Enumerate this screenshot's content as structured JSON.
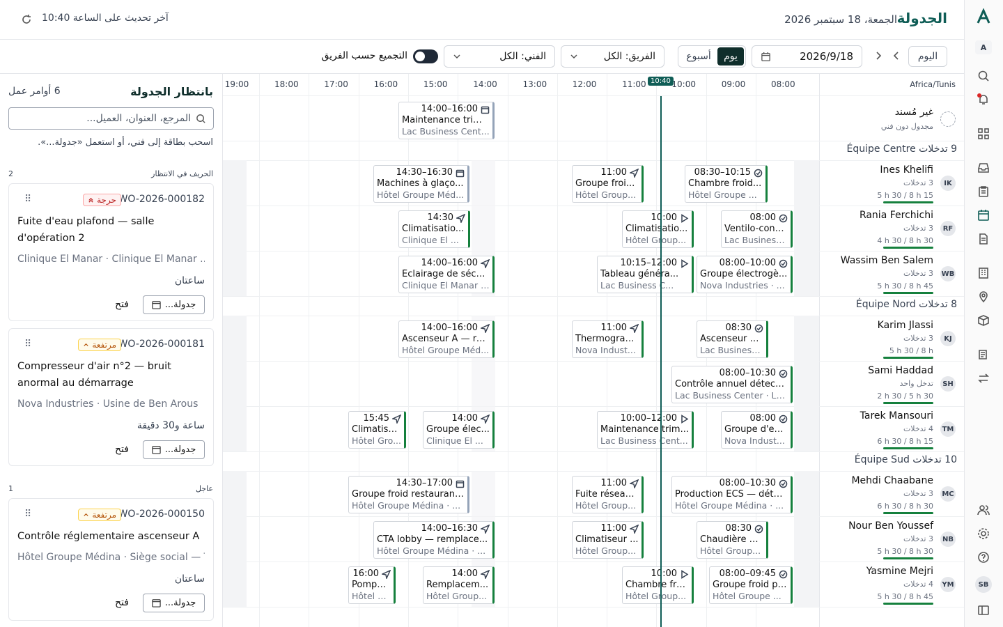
{
  "header": {
    "title": "الجدولة",
    "date": "الجمعة، 18 سبتمبر 2026",
    "last_update": "آخر تحديث على الساعة 10:40"
  },
  "toolbar": {
    "today": "اليوم",
    "date_value": "2026/9/18",
    "view_day": "يوم",
    "view_week": "أسبوع",
    "team_filter": "الفريق: الكل",
    "tech_filter": "الفني: الكل",
    "group_by_team": "التجميع حسب الفريق",
    "timezone": "Africa/Tunis"
  },
  "hours": [
    "08:00",
    "09:00",
    "10:00",
    "11:00",
    "12:00",
    "13:00",
    "14:00",
    "15:00",
    "16:00",
    "17:00",
    "18:00",
    "19:00"
  ],
  "now_label": "10:40",
  "unassigned": {
    "title": "غير مُسند",
    "sub": "مجدول دون فني"
  },
  "teams": [
    {
      "name": "Équipe Centre",
      "count": "9 تدخلات"
    },
    {
      "name": "Équipe Nord",
      "count": "8 تدخلات"
    },
    {
      "name": "Équipe Sud",
      "count": "10 تدخلات"
    }
  ],
  "techs": [
    {
      "initials": "IK",
      "name": "Ines Khelifi",
      "interventions": "3 تدخلات",
      "hours": "5 h 30 / 8 h 15"
    },
    {
      "initials": "RF",
      "name": "Rania Ferchichi",
      "interventions": "3 تدخلات",
      "hours": "4 h 30 / 8 h 30"
    },
    {
      "initials": "WB",
      "name": "Wassim Ben Salem",
      "interventions": "3 تدخلات",
      "hours": "5 h 30 / 8 h 45"
    },
    {
      "initials": "KJ",
      "name": "Karim Jlassi",
      "interventions": "3 تدخلات",
      "hours": "5 h 30 / 8 h"
    },
    {
      "initials": "SH",
      "name": "Sami Haddad",
      "interventions": "تدخل واحد",
      "hours": "2 h 30 / 5 h 30"
    },
    {
      "initials": "TM",
      "name": "Tarek Mansouri",
      "interventions": "4 تدخلات",
      "hours": "6 h 30 / 8 h 15"
    },
    {
      "initials": "MC",
      "name": "Mehdi Chaabane",
      "interventions": "3 تدخلات",
      "hours": "6 h 30 / 8 h 30"
    },
    {
      "initials": "NB",
      "name": "Nour Ben Youssef",
      "interventions": "3 تدخلات",
      "hours": "5 h 30 / 8 h 30"
    },
    {
      "initials": "YM",
      "name": "Yasmine Mejri",
      "interventions": "4 تدخلات",
      "hours": "5 h 30 / 8 h 45"
    }
  ],
  "events": [
    {
      "time": "14:00–16:00",
      "name": "Maintenance trim...",
      "client": "Lac Business Cent..."
    },
    {
      "time": "14:30–16:30",
      "name": "Machines à glaço...",
      "client": "Hôtel Groupe Méd..."
    },
    {
      "time": "11:00",
      "name": "Groupe froi...",
      "client": "Hôtel Group..."
    },
    {
      "time": "08:30–10:15",
      "name": "Chambre froid...",
      "client": "Hôtel Groupe ..."
    },
    {
      "time": "14:30",
      "name": "Climatisatio...",
      "client": "Clinique El ..."
    },
    {
      "time": "10:00",
      "name": "Climatisatio...",
      "client": "Hôtel Group..."
    },
    {
      "time": "08:00",
      "name": "Ventilo-conv...",
      "client": "Lac Business..."
    },
    {
      "time": "14:00–16:00",
      "name": "Éclairage de sécur...",
      "client": "Clinique El Manar ·..."
    },
    {
      "time": "10:15–12:00",
      "name": "Tableau généra...",
      "client": "Lac Business C..."
    },
    {
      "time": "08:00–10:00",
      "name": "Groupe électrogè...",
      "client": "Nova Industries · ..."
    },
    {
      "time": "14:00–16:00",
      "name": "Ascenseur A — re...",
      "client": "Hôtel Groupe Méd..."
    },
    {
      "time": "11:00",
      "name": "Thermograp...",
      "client": "Nova Indust..."
    },
    {
      "time": "08:30",
      "name": "Ascenseur B...",
      "client": "Lac Business..."
    },
    {
      "time": "08:00–10:30",
      "name": "Contrôle annuel détecti...",
      "client": "Lac Business Center · La..."
    },
    {
      "time": "15:45",
      "name": "Climatisa...",
      "client": "Hôtel Gro..."
    },
    {
      "time": "14:00",
      "name": "Groupe élec...",
      "client": "Clinique El ..."
    },
    {
      "time": "10:00–12:00",
      "name": "Maintenance trim...",
      "client": "Lac Business Cent..."
    },
    {
      "time": "08:00",
      "name": "Groupe d'ea...",
      "client": "Nova Indust..."
    },
    {
      "time": "14:30–17:00",
      "name": "Groupe froid restaurant...",
      "client": "Hôtel Groupe Médina · ..."
    },
    {
      "time": "11:00",
      "name": "Fuite réseau...",
      "client": "Hôtel Group..."
    },
    {
      "time": "08:00–10:30",
      "name": "Production ECS — détar...",
      "client": "Hôtel Groupe Médina · ..."
    },
    {
      "time": "14:00–16:30",
      "name": "CTA lobby — remplace...",
      "client": "Hôtel Groupe Médina · ..."
    },
    {
      "time": "11:00",
      "name": "Climatiseur ...",
      "client": "Hôtel Group..."
    },
    {
      "time": "08:30",
      "name": "Chaudière g...",
      "client": "Hôtel Group..."
    },
    {
      "time": "16:00",
      "name": "Pompe ...",
      "client": "Hôtel G..."
    },
    {
      "time": "14:00",
      "name": "Remplacem...",
      "client": "Hôtel Group..."
    },
    {
      "time": "10:00",
      "name": "Chambre fro...",
      "client": "Hôtel Group..."
    },
    {
      "time": "08:00–09:45",
      "name": "Groupe froid pi...",
      "client": "Hôtel Groupe ..."
    }
  ],
  "left": {
    "title": "بانتظار الجدولة",
    "count": "6 أوامر عمل",
    "search_placeholder": "المرجع، العنوان، العميل...",
    "hint": "اسحب بطاقة إلى فني، أو استعمل «جدولة...».",
    "group1": {
      "label": "الحريف في الانتظار",
      "count": "2"
    },
    "group2": {
      "label": "عاجل",
      "count": "1"
    },
    "schedule_label": "جدولة...",
    "open_label": "فتح",
    "cards": [
      {
        "wo": "WO-2026-000182",
        "badge": "حرجة",
        "title": "Fuite d'eau plafond — salle d'opération 2",
        "sub": "Clinique El Manar · Clinique El Manar ...",
        "dur": "ساعتان"
      },
      {
        "wo": "WO-2026-000181",
        "badge": "مرتفعة",
        "title": "Compresseur d'air n°2 — bruit anormal au démarrage",
        "sub": "Nova Industries · Usine de Ben Arous",
        "dur": "ساعة و30 دقيقة"
      },
      {
        "wo": "WO-2026-000150",
        "badge": "مرتفعة",
        "title": "Contrôle réglementaire ascenseur A",
        "sub": "Hôtel Groupe Médina · Siège social — T...",
        "dur": "ساعتان"
      }
    ]
  },
  "rail": {
    "logo": "A",
    "avatar_small": "A",
    "user": "SB"
  }
}
